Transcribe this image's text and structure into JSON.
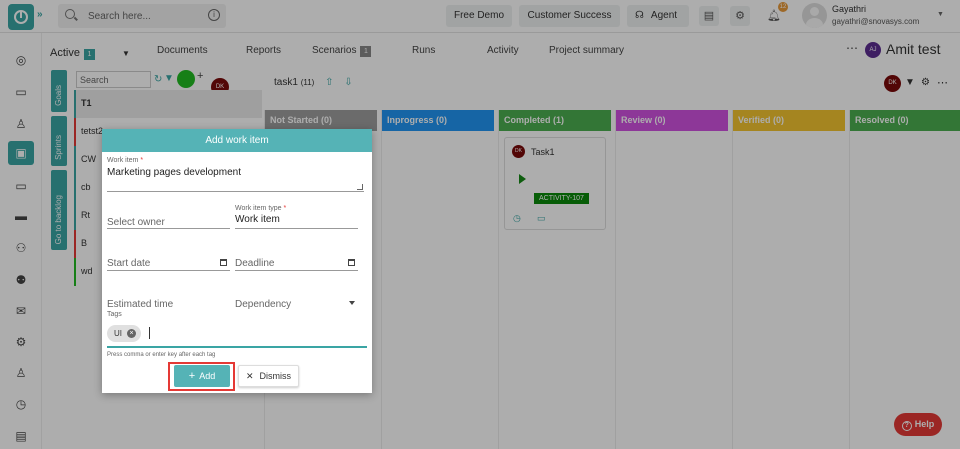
{
  "topbar": {
    "search_placeholder": "Search here...",
    "buttons": [
      "Free Demo",
      "Customer Success",
      "Agent"
    ],
    "notification_count": "12",
    "user_name": "Gayathri",
    "user_email": "gayathri@snovasys.com"
  },
  "subnav": {
    "active_label": "Active",
    "active_count": "1",
    "tabs": [
      "Documents",
      "Reports",
      "Scenarios",
      "Runs",
      "Activity",
      "Project summary"
    ],
    "scenarios_count": "1",
    "project_avatar": "AJ",
    "project_name": "Amit test"
  },
  "left_panel": {
    "vertical_tabs": [
      "Goals",
      "Sprints",
      "Go to backlog"
    ],
    "search_placeholder": "Search",
    "avatar": "DK",
    "rows": [
      "T1",
      "tetst2",
      "CW",
      "cb",
      "Rt",
      "B",
      "wd"
    ]
  },
  "board": {
    "title": "task1",
    "count": "(11)",
    "avatar": "DK",
    "columns": [
      {
        "label": "Not Started (0)",
        "color": "#9e9e9e"
      },
      {
        "label": "Inprogress (0)",
        "color": "#2196f3"
      },
      {
        "label": "Completed (1)",
        "color": "#4caf50"
      },
      {
        "label": "Review (0)",
        "color": "#d052e0"
      },
      {
        "label": "Verified (0)",
        "color": "#f4c430"
      },
      {
        "label": "Resolved (0)",
        "color": "#4caf50"
      }
    ],
    "card": {
      "avatar": "DK",
      "title": "Task1",
      "activity": "ACTIVITY-107"
    }
  },
  "modal": {
    "title": "Add work item",
    "work_item_label": "Work item",
    "work_item_value": "Marketing pages development",
    "owner_placeholder": "Select owner",
    "type_label": "Work item type",
    "type_value": "Work item",
    "start_date_placeholder": "Start date",
    "deadline_placeholder": "Deadline",
    "estimated_time_placeholder": "Estimated time",
    "dependency_placeholder": "Dependency",
    "tags_label": "Tags",
    "tag_chip": "UI",
    "tags_hint": "Press comma or enter key after each tag",
    "add_label": "Add",
    "dismiss_label": "Dismiss"
  },
  "help_label": "Help"
}
